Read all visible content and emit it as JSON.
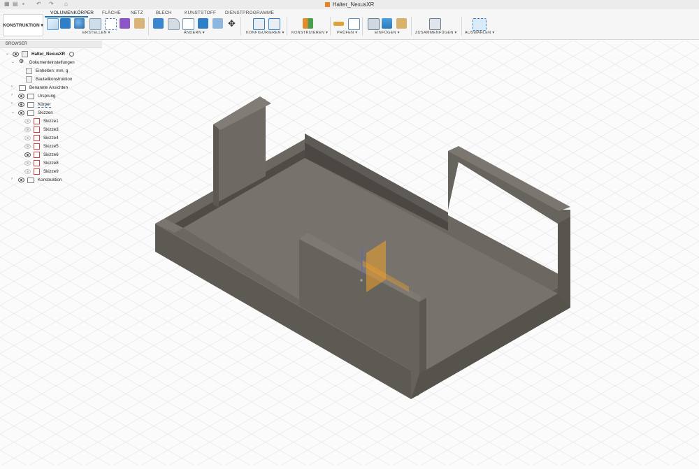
{
  "window": {
    "title": "Halter_NexusXR"
  },
  "toolbar": {
    "workspace": "KONSTRUKTION",
    "tabs": [
      "VOLUMENKÖRPER",
      "FLÄCHE",
      "NETZ",
      "BLECH",
      "KUNSTSTOFF",
      "DIENSTPROGRAMME"
    ],
    "groups": [
      "ERSTELLEN",
      "ÄNDERN",
      "KONFIGURIEREN",
      "KONSTRUIEREN",
      "PRÜFEN",
      "EINFÜGEN",
      "ZUSAMMENFÜGEN",
      "AUSWÄHLEN"
    ]
  },
  "browser": {
    "header": "BROWSER",
    "items": [
      {
        "label": "Halter_NexusXR"
      },
      {
        "label": "Dokumenteinstellungen"
      },
      {
        "label": "Einheiten: mm, g"
      },
      {
        "label": "Bauteilkonstruktion"
      },
      {
        "label": "Benannte Ansichten"
      },
      {
        "label": "Ursprung"
      },
      {
        "label": "Körper"
      },
      {
        "label": "Skizzen"
      },
      {
        "label": "Skizze1"
      },
      {
        "label": "Skizze3"
      },
      {
        "label": "Skizze4"
      },
      {
        "label": "Skizze5"
      },
      {
        "label": "Skizze6"
      },
      {
        "label": "Skizze8"
      },
      {
        "label": "Skizze9"
      },
      {
        "label": "Konstruktion"
      }
    ]
  },
  "colors": {
    "accent": "#1b75bc",
    "model_top": "#6e6a63",
    "model_floor": "#75706a",
    "model_side": "#5f5b55",
    "plane_highlight": "#f0a12a"
  },
  "icons": [
    "home-icon",
    "undo-icon",
    "redo-icon",
    "save-icon",
    "eye-icon",
    "folder-icon",
    "gear-icon",
    "sketch-icon",
    "cube-icon"
  ]
}
